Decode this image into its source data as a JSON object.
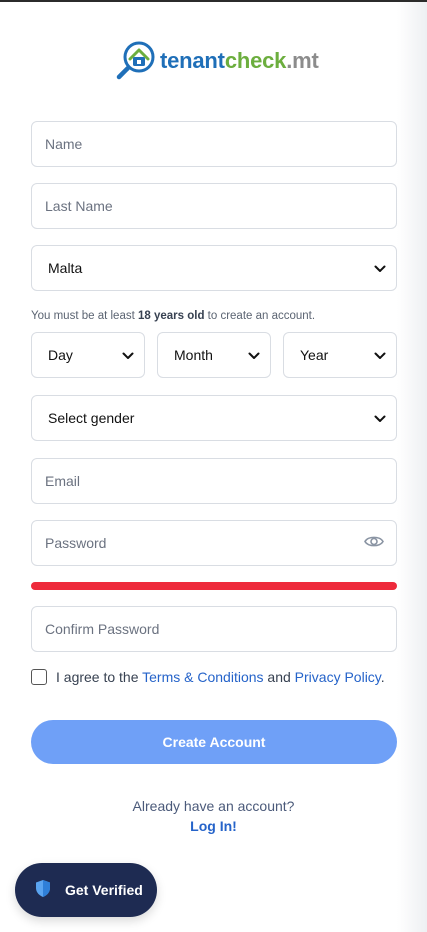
{
  "brand": {
    "name_part1": "tenant",
    "name_part2": "check",
    "name_part3": ".mt"
  },
  "form": {
    "name_placeholder": "Name",
    "last_name_placeholder": "Last Name",
    "country_value": "Malta",
    "age_note_prefix": "You must be at least ",
    "age_note_bold": "18 years old",
    "age_note_suffix": " to create an account.",
    "day_value": "Day",
    "month_value": "Month",
    "year_value": "Year",
    "gender_value": "Select gender",
    "email_placeholder": "Email",
    "password_placeholder": "Password",
    "confirm_password_placeholder": "Confirm Password",
    "agree_prefix": "I agree to the ",
    "terms_link": "Terms & Conditions",
    "agree_mid": " and ",
    "privacy_link": "Privacy Policy",
    "agree_suffix": ".",
    "create_button": "Create Account"
  },
  "footer": {
    "already_text": "Already have an account?",
    "login_link": "Log In!"
  },
  "floating": {
    "verify_button": "Get Verified"
  },
  "colors": {
    "primary": "#2563c9",
    "button_disabled": "#6fa0f7",
    "strength_weak": "#ee2a3b",
    "verify_bg": "#1e2b52"
  },
  "icons": [
    "magnifier-house-logo-icon",
    "chevron-down-icon",
    "eye-icon",
    "shield-icon"
  ]
}
